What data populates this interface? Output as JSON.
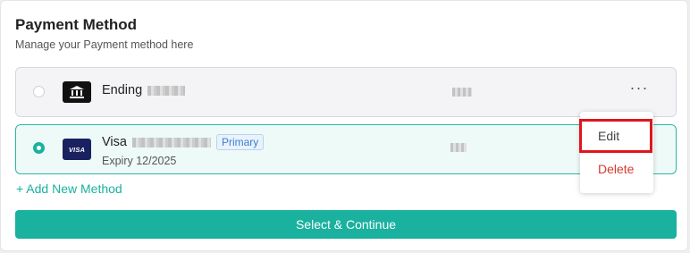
{
  "header": {
    "title": "Payment Method",
    "subtitle": "Manage your Payment method here"
  },
  "methods": [
    {
      "label": "Ending",
      "icon": "bank-icon",
      "selected": false
    },
    {
      "label": "Visa",
      "icon": "visa-card-icon",
      "card_brand_text": "VISA",
      "badge": "Primary",
      "expiry": "Expiry 12/2025",
      "selected": true
    }
  ],
  "actions": {
    "add_method": "+ Add New Method",
    "continue": "Select & Continue"
  },
  "context_menu": {
    "edit": "Edit",
    "delete": "Delete"
  },
  "colors": {
    "accent": "#1ab19f",
    "danger": "#d73b2f",
    "highlight_box": "#e0151c",
    "badge": "#3a80d0"
  }
}
